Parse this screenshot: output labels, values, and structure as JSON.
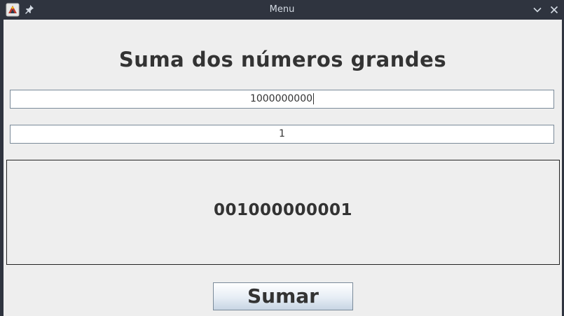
{
  "window": {
    "title": "Menu",
    "icons": {
      "app": "java-app-icon",
      "pin": "pin-icon",
      "minimize": "chevron-down-icon",
      "close": "close-icon"
    }
  },
  "main": {
    "heading": "Suma dos números grandes",
    "input_first": {
      "value": "1000000000"
    },
    "input_second": {
      "value": "1"
    },
    "result": "001000000001",
    "sum_button_label": "Sumar"
  },
  "colors": {
    "titlebar": "#2f343f",
    "panel": "#eeeeee",
    "text": "#333333"
  }
}
